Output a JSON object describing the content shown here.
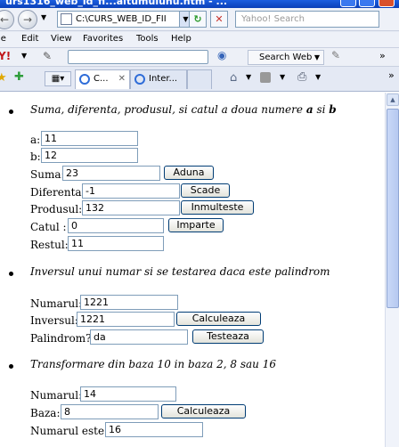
{
  "browser": {
    "title": "urs1316_web_id_fi...aitumulunu.htm - ...",
    "address": "C:\\CURS_WEB_ID_FII",
    "search_placeholder": "Yahoo! Search",
    "menu": [
      "le",
      "Edit",
      "View",
      "Favorites",
      "Tools",
      "Help"
    ],
    "toolbar": {
      "search_web_label": "Search Web"
    },
    "tabs": [
      {
        "label": "C..."
      },
      {
        "label": "Inter..."
      }
    ],
    "icons": {
      "back": "back-arrow-icon",
      "forward": "forward-arrow-icon",
      "refresh": "refresh-icon",
      "stop": "stop-icon",
      "home": "home-icon",
      "rss": "rss-icon",
      "print": "print-icon"
    }
  },
  "section1": {
    "heading_prefix": "Suma, diferenta, produsul, si catul a doua numere",
    "heading_a": "a",
    "heading_si": "si",
    "heading_b": "b",
    "label_a": "a:",
    "value_a": "11",
    "label_b": "b:",
    "value_b": "12",
    "label_suma": "Suma:",
    "value_suma": "23",
    "btn_suma": "Aduna",
    "label_diferenta": "Diferenta:",
    "value_diferenta": "-1",
    "btn_diferenta": "Scade",
    "label_produsul": "Produsul:",
    "value_produsul": "132",
    "btn_produsul": "Inmulteste",
    "label_catul": "Catul :",
    "value_catul": "0",
    "btn_catul": "Imparte",
    "label_restul": "Restul:",
    "value_restul": "11"
  },
  "section2": {
    "heading": "Inversul unui numar si se testarea daca este palindrom",
    "label_numarul": "Numarul:",
    "value_numarul": "1221",
    "label_inversul": "Inversul:",
    "value_inversul": "1221",
    "btn_inversul": "Calculeaza",
    "label_palindrom": "Palindrom?",
    "value_palindrom": "da",
    "btn_palindrom": "Testeaza"
  },
  "section3": {
    "heading": "Transformare din baza 10 in baza 2, 8 sau 16",
    "label_numarul": "Numarul:",
    "value_numarul": "14",
    "label_baza": "Baza:",
    "value_baza": "8",
    "btn_baza": "Calculeaza",
    "label_rezultat": "Numarul este:",
    "value_rezultat": "16"
  }
}
